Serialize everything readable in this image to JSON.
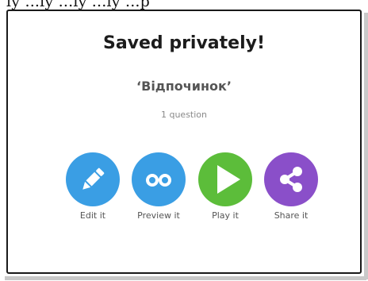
{
  "background_text": "ly ...ly ...ly ...ly ...p",
  "dialog": {
    "title": "Saved privately!",
    "quiz_name": "‘Відпочинок’",
    "question_count": "1 question"
  },
  "actions": [
    {
      "label": "Edit it",
      "icon": "pencil-icon",
      "color": "#3a9ee4"
    },
    {
      "label": "Preview it",
      "icon": "glasses-icon",
      "color": "#3a9ee4"
    },
    {
      "label": "Play it",
      "icon": "play-icon",
      "color": "#5cbd3a"
    },
    {
      "label": "Share it",
      "icon": "share-icon",
      "color": "#8a4fc9"
    }
  ]
}
